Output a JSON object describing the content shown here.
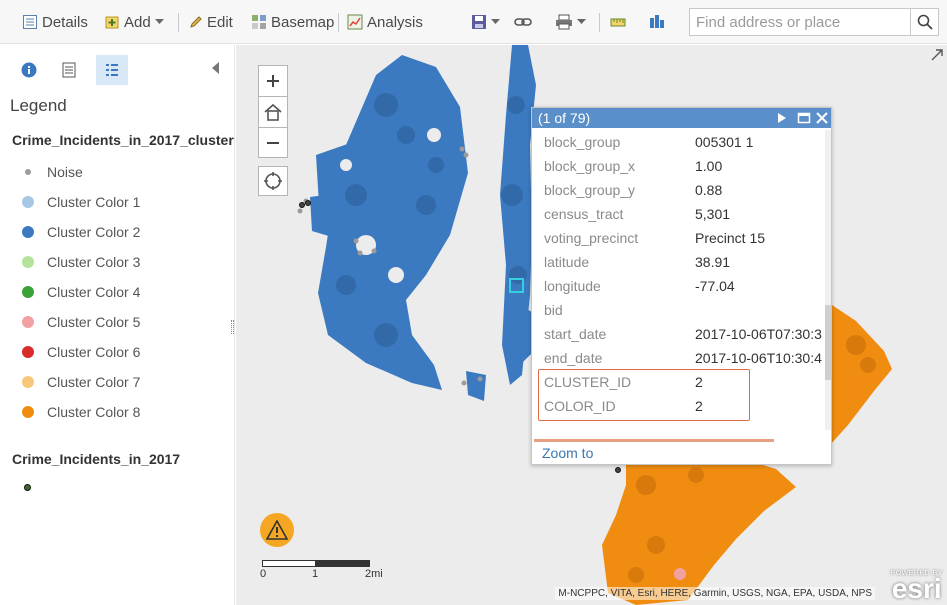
{
  "toolbar": {
    "details": "Details",
    "add": "Add",
    "edit": "Edit",
    "basemap": "Basemap",
    "analysis": "Analysis",
    "search_placeholder": "Find address or place"
  },
  "sidebar": {
    "legend_title": "Legend",
    "layer1_title": "Crime_Incidents_in_2017_cluster",
    "layer1_items": [
      {
        "label": "Noise",
        "color": "#9b9b9b"
      },
      {
        "label": "Cluster Color 1",
        "color": "#a6c8e4"
      },
      {
        "label": "Cluster Color 2",
        "color": "#3b7ac1"
      },
      {
        "label": "Cluster Color 3",
        "color": "#b6e39c"
      },
      {
        "label": "Cluster Color 4",
        "color": "#3aa238"
      },
      {
        "label": "Cluster Color 5",
        "color": "#f2a0a0"
      },
      {
        "label": "Cluster Color 6",
        "color": "#d92b2b"
      },
      {
        "label": "Cluster Color 7",
        "color": "#f8c87a"
      },
      {
        "label": "Cluster Color 8",
        "color": "#f08c10"
      }
    ],
    "layer2_title": "Crime_Incidents_in_2017"
  },
  "popup": {
    "count": "(1 of 79)",
    "fields": [
      {
        "key": "block_group",
        "value": "005301 1"
      },
      {
        "key": "block_group_x",
        "value": "1.00"
      },
      {
        "key": "block_group_y",
        "value": "0.88"
      },
      {
        "key": "census_tract",
        "value": "5,301"
      },
      {
        "key": "voting_precinct",
        "value": "Precinct 15"
      },
      {
        "key": "latitude",
        "value": "38.91"
      },
      {
        "key": "longitude",
        "value": "-77.04"
      },
      {
        "key": "bid",
        "value": ""
      },
      {
        "key": "start_date",
        "value": "2017-10-06T07:30:3"
      },
      {
        "key": "end_date",
        "value": "2017-10-06T10:30:4"
      },
      {
        "key": "CLUSTER_ID",
        "value": "2"
      },
      {
        "key": "COLOR_ID",
        "value": "2"
      }
    ],
    "zoom_to": "Zoom to"
  },
  "map": {
    "scale_labels": [
      "0",
      "1",
      "2mi"
    ],
    "attribution": "M-NCPPC, VITA, Esri, HERE, Garmin, USGS, NGA, EPA, USDA, NPS",
    "esri_powered": "POWERED BY",
    "esri_name": "esri"
  },
  "colors": {
    "cluster_blue": "#3b7ac1",
    "cluster_orange": "#f08c10",
    "popup_header": "#5b8fc9",
    "highlight": "#e06a48"
  }
}
